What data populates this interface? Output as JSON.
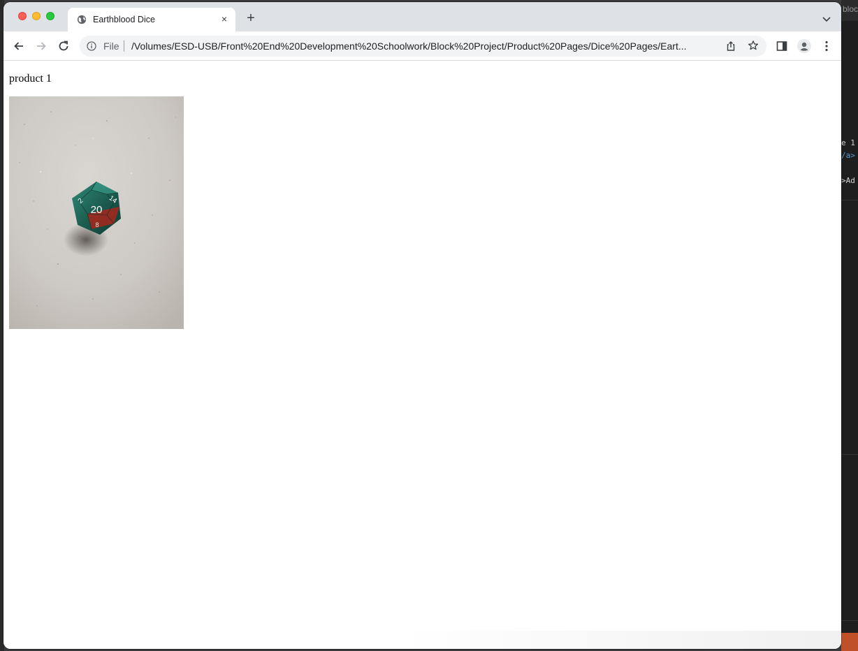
{
  "browser": {
    "tab": {
      "title": "Earthblood Dice",
      "close_glyph": "×"
    },
    "new_tab_glyph": "+",
    "address_bar": {
      "scheme_label": "File",
      "url": "/Volumes/ESD-USB/Front%20End%20Development%20Schoolwork/Block%20Project/Product%20Pages/Dice%20Pages/Eart..."
    },
    "icons": {
      "back": "back-arrow-icon",
      "forward": "forward-arrow-icon",
      "reload": "reload-icon",
      "info": "info-icon",
      "share": "share-icon",
      "bookmark": "star-icon",
      "side_panel": "side-panel-icon",
      "profile": "profile-icon",
      "menu": "kebab-menu-icon",
      "tab_search": "chevron-down-icon"
    }
  },
  "page": {
    "heading": "product 1",
    "image": {
      "description_icon": "d20-dice-photo",
      "die_numbers": [
        "20",
        "14",
        "2",
        "8"
      ],
      "colors": {
        "surface": "#cfcbc6",
        "die_green": "#1f6b5c",
        "die_red": "#b02a1e"
      }
    }
  },
  "background_app": {
    "top_text": "bloc",
    "code_lines": [
      "e 1",
      "/a>",
      ">Ad"
    ]
  }
}
